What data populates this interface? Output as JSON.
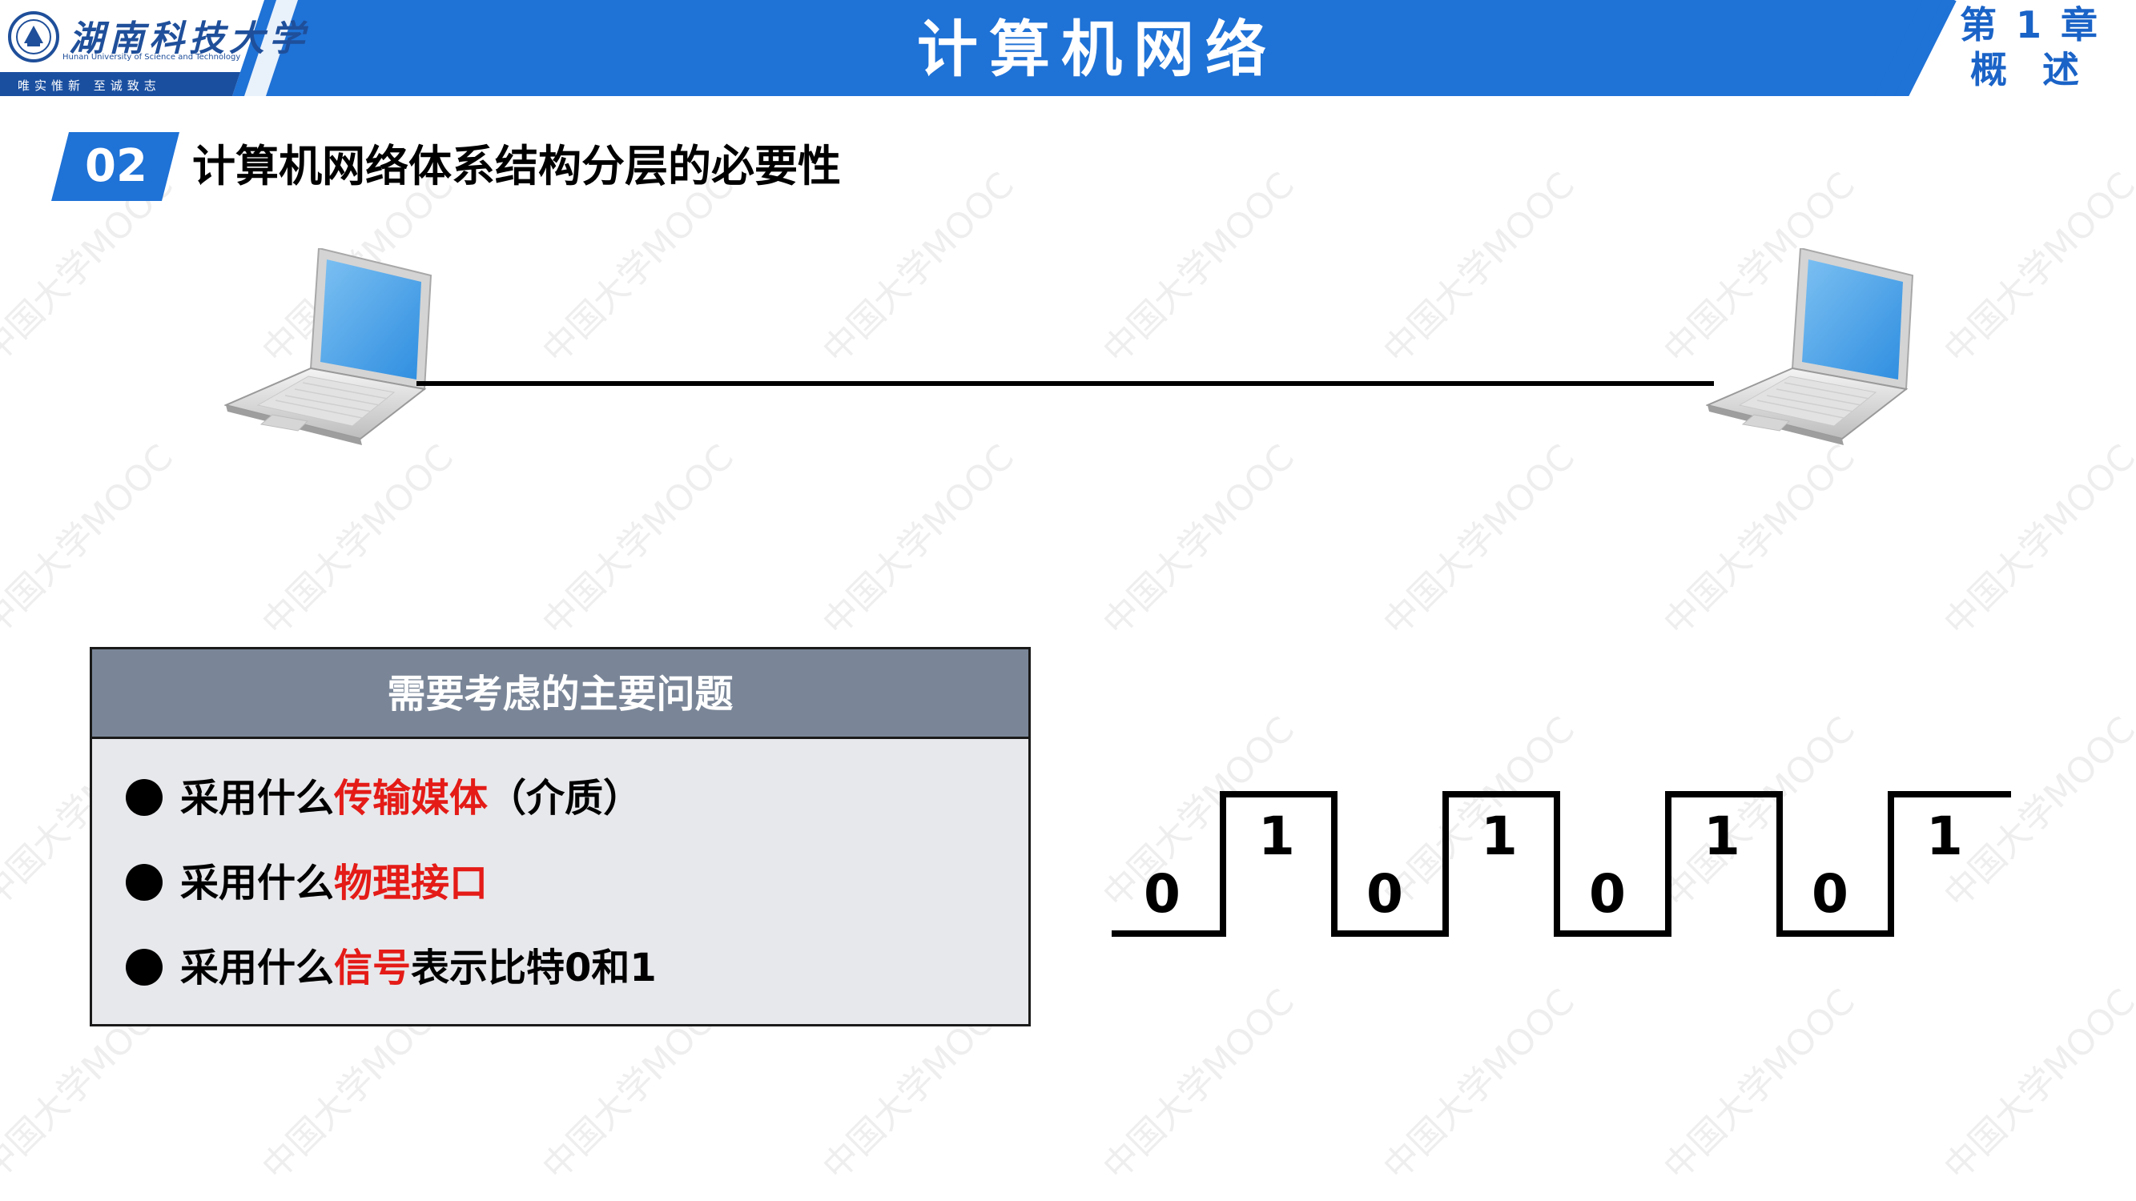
{
  "header": {
    "university_name_cn": "湖南科技大学",
    "university_name_en": "Hunan University of Science and Technology",
    "university_motto": "唯实惟新  至诚致志",
    "course_title": "计算机网络",
    "chapter_label": "第 1 章",
    "chapter_title": "概 述",
    "bar_color": "#1f72d6",
    "accent_color": "#1a63c7"
  },
  "section": {
    "number": "02",
    "title": "计算机网络体系结构分层的必要性",
    "badge_color": "#1f72d6"
  },
  "diagram": {
    "left_host_icon": "laptop-icon",
    "right_host_icon": "laptop-icon",
    "link": "transmission-line"
  },
  "questions": {
    "title": "需要考虑的主要问题",
    "header_color": "#7a8698",
    "items": [
      {
        "prefix": "采用什么",
        "highlight": "传输媒体",
        "suffix": "（介质）"
      },
      {
        "prefix": "采用什么",
        "highlight": "物理接口",
        "suffix": ""
      },
      {
        "prefix": "采用什么",
        "highlight": "信号",
        "suffix": "表示比特0和1"
      }
    ],
    "highlight_color": "#e41b17"
  },
  "signal": {
    "bits": [
      "0",
      "1",
      "0",
      "1",
      "0",
      "1",
      "0",
      "1"
    ]
  },
  "watermark": {
    "text": "中国大学MOOC"
  }
}
